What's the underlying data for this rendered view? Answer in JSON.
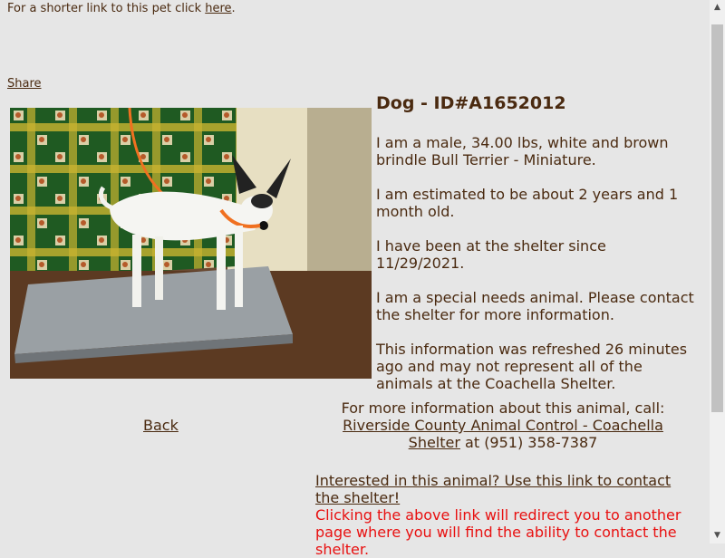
{
  "top_note": {
    "text": "For a shorter link to this pet click ",
    "link": "here",
    "end": "."
  },
  "share_label": "Share",
  "pet": {
    "title": "Dog - ID#A1652012",
    "description": "I am a male, 34.00 lbs, white and brown brindle Bull Terrier - Miniature.",
    "age": "I am estimated to be about 2 years and 1 month old.",
    "since": "I have been at the shelter since 11/29/2021.",
    "special": "I am a special needs animal. Please contact the shelter for more information.",
    "refresh": "This information was refreshed 26 minutes ago and may not represent all of the animals at the Coachella Shelter."
  },
  "back_label": "Back",
  "contact": {
    "intro": "For more information about this animal, call:",
    "shelter_link": "Riverside County Animal Control - Coachella Shelter",
    "phone": " at (951) 358-7387"
  },
  "interest": {
    "link": "Interested in this animal? Use this link to contact the shelter!",
    "warning": "Clicking the above link will redirect you to another page where you will find the ability to contact the shelter."
  },
  "colors": {
    "text": "#4a2a10",
    "warning": "#e81010",
    "background": "#e6e6e6"
  }
}
